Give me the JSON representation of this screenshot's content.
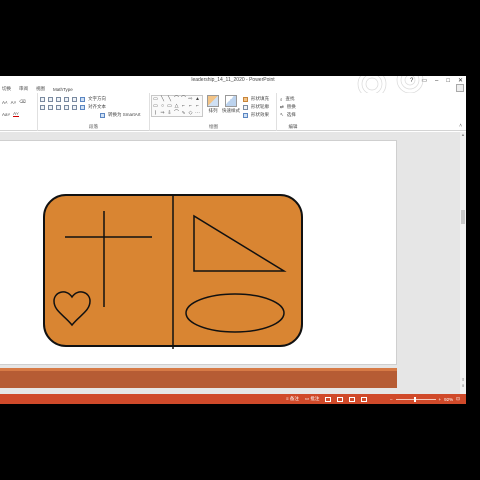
{
  "window": {
    "title": "leadership_14_11_2020 - PowerPoint",
    "controls": [
      "?",
      "▭",
      "–",
      "□",
      "✕"
    ]
  },
  "tabs": [
    "切换",
    "审阅",
    "视图",
    "MathType"
  ],
  "ribbon": {
    "groups": {
      "paragraph": {
        "label": "段落",
        "text_direction": "文字方向",
        "align_text": "对齐文本",
        "smartart": "转换为 SmartArt"
      },
      "drawing": {
        "label": "绘图",
        "arrange": "排列",
        "quick_styles": "快速样式",
        "shape_fill": "形状填充",
        "shape_outline": "形状轮廓",
        "shape_effects": "形状效果"
      },
      "editing": {
        "label": "编辑",
        "find": "查找",
        "replace": "替换",
        "select": "选择"
      }
    },
    "shape_gallery": [
      "▭",
      "╲",
      "╲",
      "⌒",
      "⌒",
      "⇨",
      "▲",
      "▭",
      "○",
      "▭",
      "△",
      "⌐",
      "⌐",
      "⌐",
      "⟩",
      "⇒",
      "⇩",
      "⌒",
      "∿",
      "◇",
      "⋯"
    ]
  },
  "slide": {
    "shape_fill": "#d98532",
    "outline": "#111111"
  },
  "statusbar": {
    "notes": "备注",
    "comments": "批注",
    "zoom": "92%"
  },
  "colors": {
    "status_bg": "#d04a2a",
    "strip": "#b65c34",
    "accent_orange": "#d98532"
  }
}
